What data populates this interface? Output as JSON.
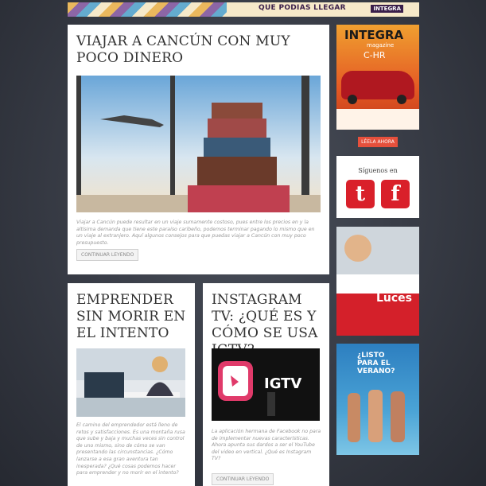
{
  "banner": {
    "text": "QUE PODIAS LLEGAR",
    "brand": "INTEGRA"
  },
  "posts": [
    {
      "title": "VIAJAR A CANCÚN CON MUY POCO DINERO",
      "excerpt": "Viajar a Cancún puede resultar en un viaje sumamente costoso, pues entre los precios en y la altísima demanda que tiene este paraíso caribeño, podemos terminar pagando lo mismo que en un viaje al extranjero. Aquí algunos consejos para que puedas viajar a Cancún con muy poco presupuesto.",
      "button": "CONTINUAR LEYENDO"
    },
    {
      "title": "EMPRENDER SIN MORIR EN EL INTENTO",
      "excerpt": "El camino del emprendedor está lleno de retos y satisfacciones. Es una montaña rusa que sube y baja y muchas veces sin control de uno mismo, sino de cómo se van presentando las circunstancias. ¿Cómo lanzarse a esa gran aventura tan inesperada? ¿Qué cosas podemos hacer para emprender y no morir en el intento?"
    },
    {
      "title": "INSTAGRAM TV: ¿QUÉ ES Y CÓMO SE USA IGTV?",
      "excerpt": "La aplicación hermana de Facebook no para de implementar nuevas características. Ahora apunta sus dardos a ser el YouTube del video en vertical. ¿Qué es Instagram TV?",
      "button": "CONTINUAR LEYENDO",
      "image_text": "IGTV"
    }
  ],
  "sidebar": {
    "magazine": {
      "name": "INTEGRA",
      "sub": "magazine",
      "model": "C-HR"
    },
    "read_button": "LÉELA AHORA",
    "follow_title": "Síguenos en",
    "social": [
      "t",
      "f"
    ],
    "ad1": {
      "brand": "Luces"
    },
    "ad2": {
      "line1": "¿LISTO",
      "line2": "PARA EL",
      "line3": "VERANO?"
    }
  },
  "colors": {
    "accent": "#e6503c",
    "social": "#d9202a"
  }
}
